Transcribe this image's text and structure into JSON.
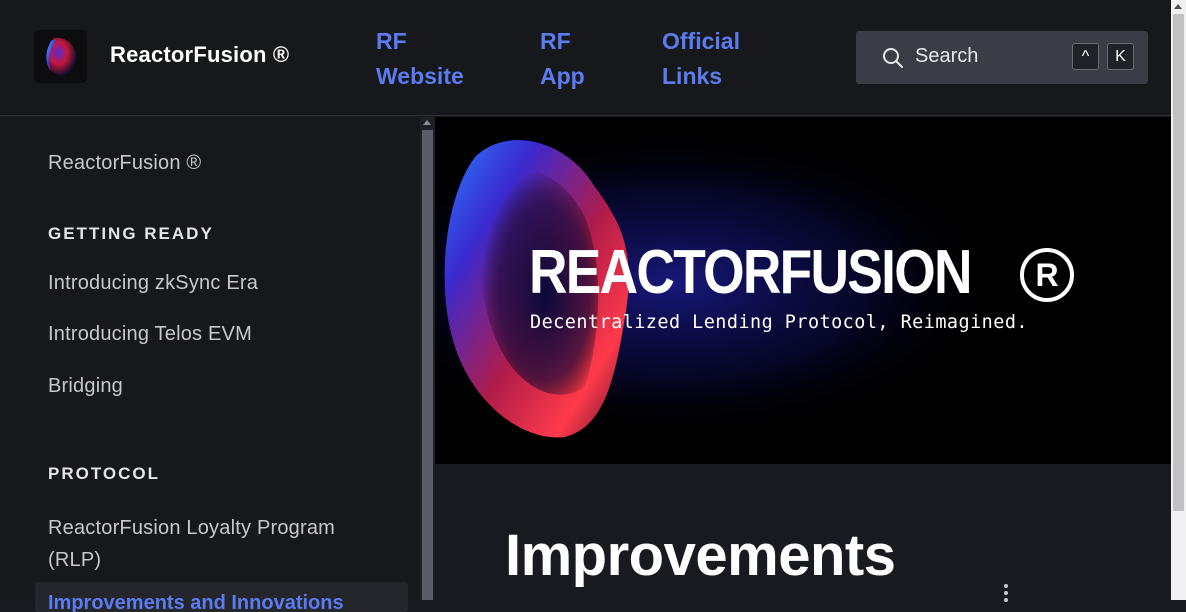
{
  "header": {
    "brand": "ReactorFusion ®",
    "nav": [
      {
        "line1": "RF",
        "line2": "Website"
      },
      {
        "line1": "RF",
        "line2": "App"
      },
      {
        "line1": "Official",
        "line2": "Links"
      }
    ],
    "search": {
      "placeholder": "Search",
      "key1": "^",
      "key2": "K"
    }
  },
  "sidebar": {
    "top_item": "ReactorFusion ®",
    "sections": [
      {
        "heading": "GETTING READY",
        "items": [
          "Introducing zkSync Era",
          "Introducing Telos EVM",
          "Bridging"
        ]
      },
      {
        "heading": "PROTOCOL",
        "items": [
          "ReactorFusion Loyalty Program (RLP)",
          "Improvements and Innovations"
        ]
      }
    ],
    "rlp_line1": "ReactorFusion Loyalty Program",
    "rlp_line2": "(RLP)",
    "active_item": "Improvements and Innovations"
  },
  "hero": {
    "title": "REACTORFUSION",
    "reg_mark": "R",
    "subtitle": "Decentralized Lending Protocol, Reimagined."
  },
  "main": {
    "page_title": "Improvements"
  },
  "colors": {
    "accent": "#5b7cf0",
    "background": "#181a1f",
    "header_bg": "#16181c",
    "search_bg": "#3a3d43"
  }
}
